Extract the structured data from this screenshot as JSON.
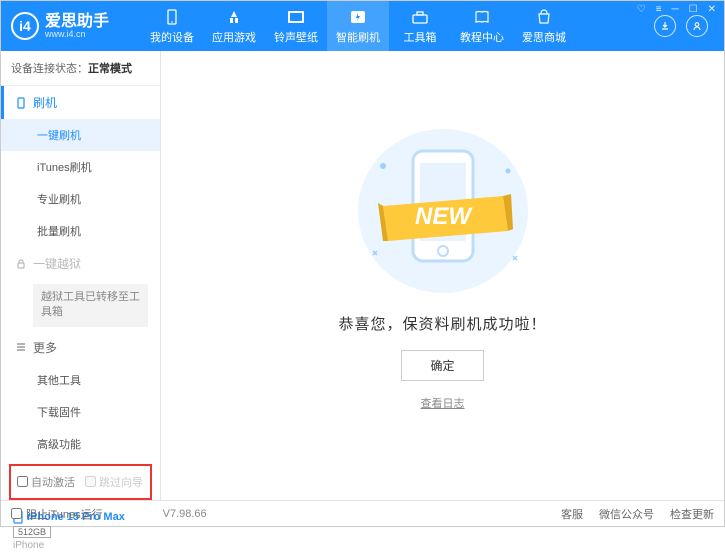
{
  "header": {
    "title": "爱思助手",
    "subtitle": "www.i4.cn",
    "nav": [
      {
        "label": "我的设备"
      },
      {
        "label": "应用游戏"
      },
      {
        "label": "铃声壁纸"
      },
      {
        "label": "智能刷机"
      },
      {
        "label": "工具箱"
      },
      {
        "label": "教程中心"
      },
      {
        "label": "爱思商城"
      }
    ]
  },
  "sidebar": {
    "status_label": "设备连接状态：",
    "status_value": "正常模式",
    "section_flash": "刷机",
    "items_flash": [
      "一键刷机",
      "iTunes刷机",
      "专业刷机",
      "批量刷机"
    ],
    "section_jailbreak": "一键越狱",
    "jailbreak_note": "越狱工具已转移至工具箱",
    "section_more": "更多",
    "items_more": [
      "其他工具",
      "下载固件",
      "高级功能"
    ],
    "check_auto_activate": "自动激活",
    "check_skip_guide": "跳过向导",
    "device_name": "iPhone 15 Pro Max",
    "device_storage": "512GB",
    "device_type": "iPhone"
  },
  "main": {
    "new_banner": "NEW",
    "success_text": "恭喜您，保资料刷机成功啦！",
    "ok_label": "确定",
    "log_link": "查看日志"
  },
  "footer": {
    "block_itunes": "阻止iTunes运行",
    "version": "V7.98.66",
    "support": "客服",
    "wechat": "微信公众号",
    "check_update": "检查更新"
  }
}
